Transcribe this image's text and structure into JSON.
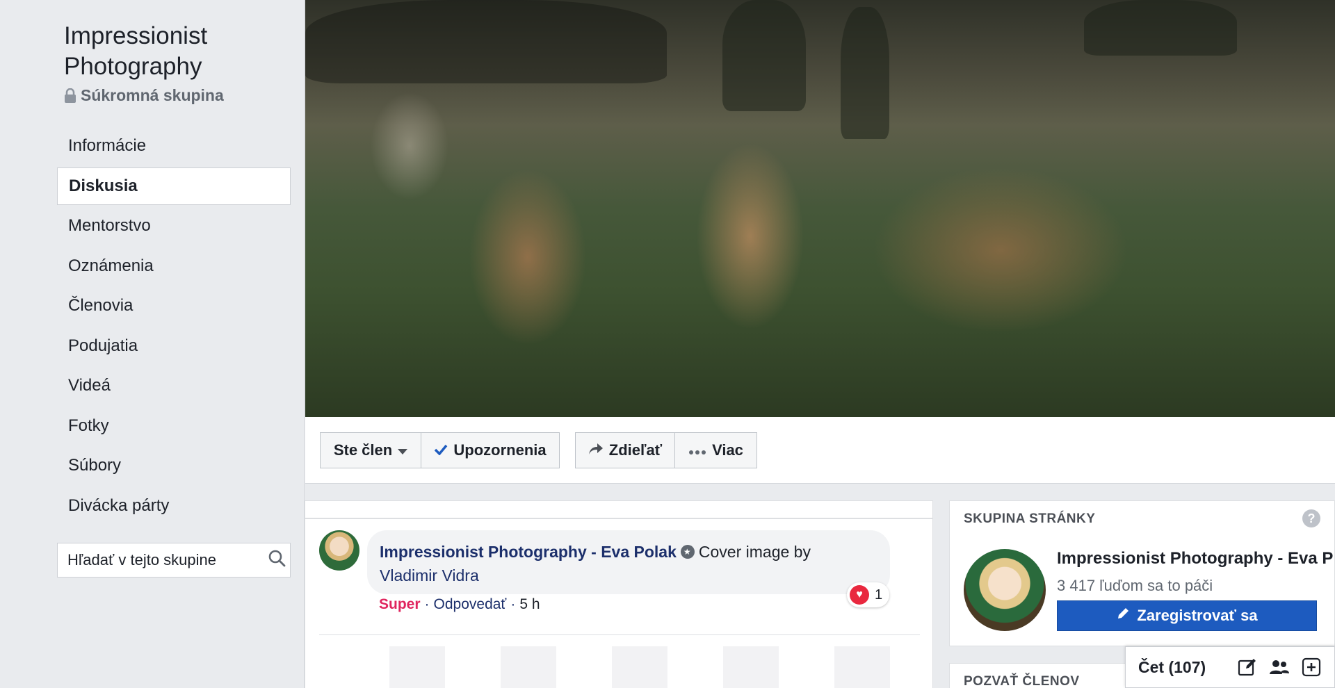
{
  "group": {
    "title": "Impressionist Photography",
    "privacy": "Súkromná skupina"
  },
  "nav": {
    "items": [
      {
        "label": "Informácie"
      },
      {
        "label": "Diskusia",
        "active": true
      },
      {
        "label": "Mentorstvo"
      },
      {
        "label": "Oznámenia"
      },
      {
        "label": "Členovia"
      },
      {
        "label": "Podujatia"
      },
      {
        "label": "Videá"
      },
      {
        "label": "Fotky"
      },
      {
        "label": "Súbory"
      },
      {
        "label": "Divácka párty"
      }
    ]
  },
  "search": {
    "placeholder": "Hľadať v tejto skupine"
  },
  "actions": {
    "member": "Ste člen",
    "notifications": "Upozornenia",
    "share": "Zdieľať",
    "more": "Viac"
  },
  "comment": {
    "author": "Impressionist Photography - Eva Polak",
    "text": "Cover image by",
    "link": "Vladimir Vidra",
    "reaction_count": "1",
    "reaction_label": "Super",
    "reply": "Odpovedať",
    "separator": "·",
    "time": "5 h"
  },
  "page_card": {
    "heading": "SKUPINA STRÁNKY",
    "help": "?",
    "name": "Impressionist Photography - Eva P",
    "likes": "3 417 ľuďom sa to páči",
    "register": "Zaregistrovať sa"
  },
  "invite": {
    "heading": "POZVAŤ ČLENOV"
  },
  "chat": {
    "label": "Čet (107)"
  },
  "colors": {
    "link_blue": "#1c2f6b",
    "primary_button": "#1d5bbf",
    "love_red": "#e9283f",
    "sidebar_bg": "#e9ebee"
  }
}
